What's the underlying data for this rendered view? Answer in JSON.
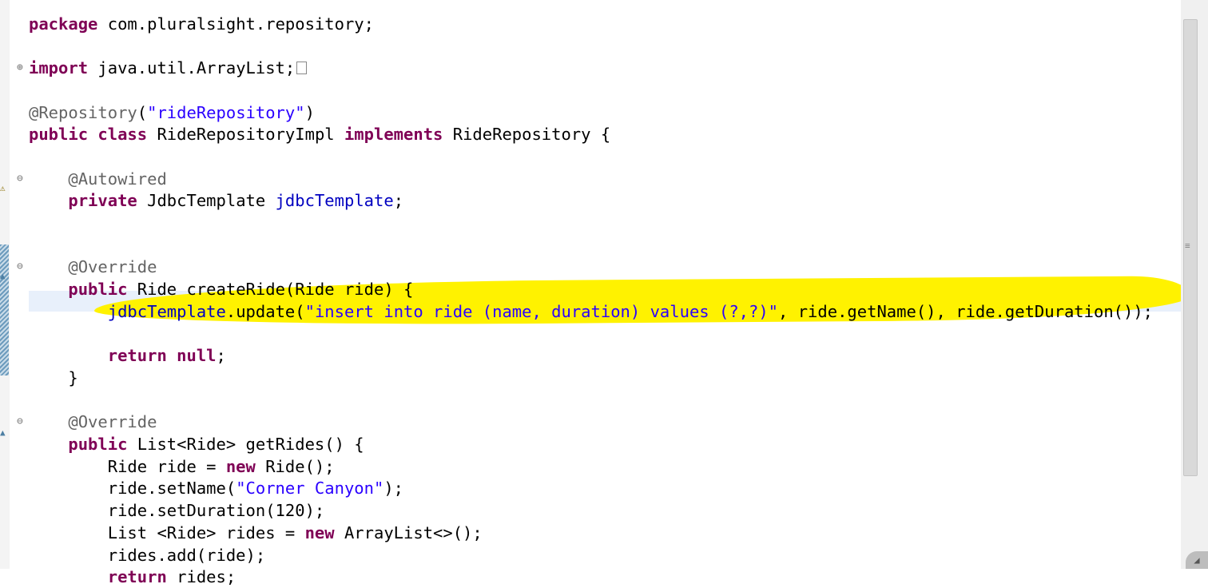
{
  "editor": {
    "language": "java",
    "lines": [
      {
        "row": 1,
        "tokens": [
          {
            "t": "package",
            "c": "kw"
          },
          {
            "t": " com.pluralsight.repository;"
          }
        ]
      },
      {
        "row": 3,
        "tokens": [
          {
            "t": "import",
            "c": "kw"
          },
          {
            "t": " java.util.ArrayList;"
          }
        ],
        "folded": true
      },
      {
        "row": 5,
        "tokens": [
          {
            "t": "@Repository",
            "c": "ann"
          },
          {
            "t": "("
          },
          {
            "t": "\"rideRepository\"",
            "c": "str"
          },
          {
            "t": ")"
          }
        ]
      },
      {
        "row": 6,
        "tokens": [
          {
            "t": "public",
            "c": "kw"
          },
          {
            "t": " "
          },
          {
            "t": "class",
            "c": "kw"
          },
          {
            "t": " RideRepositoryImpl "
          },
          {
            "t": "implements",
            "c": "kw"
          },
          {
            "t": " RideRepository {"
          }
        ]
      },
      {
        "row": 8,
        "tokens": [
          {
            "t": "    "
          },
          {
            "t": "@Autowired",
            "c": "ann"
          }
        ]
      },
      {
        "row": 9,
        "tokens": [
          {
            "t": "    "
          },
          {
            "t": "private",
            "c": "kw"
          },
          {
            "t": " JdbcTemplate "
          },
          {
            "t": "jdbcTemplate",
            "c": "field"
          },
          {
            "t": ";"
          }
        ]
      },
      {
        "row": 12,
        "tokens": [
          {
            "t": "    "
          },
          {
            "t": "@Override",
            "c": "ann"
          }
        ]
      },
      {
        "row": 13,
        "tokens": [
          {
            "t": "    "
          },
          {
            "t": "public",
            "c": "kw"
          },
          {
            "t": " Ride createRide(Ride ride) {"
          }
        ]
      },
      {
        "row": 14,
        "tokens": [
          {
            "t": "        "
          },
          {
            "t": "jdbcTemplate",
            "c": "field"
          },
          {
            "t": ".update("
          },
          {
            "t": "\"insert into ride (name, duration) values (?,?)\"",
            "c": "str"
          },
          {
            "t": ", ride.getName(), ride.getDuration());"
          }
        ],
        "current": true
      },
      {
        "row": 16,
        "tokens": [
          {
            "t": "        "
          },
          {
            "t": "return",
            "c": "kw"
          },
          {
            "t": " "
          },
          {
            "t": "null",
            "c": "kw"
          },
          {
            "t": ";"
          }
        ]
      },
      {
        "row": 17,
        "tokens": [
          {
            "t": "    }"
          }
        ]
      },
      {
        "row": 19,
        "tokens": [
          {
            "t": "    "
          },
          {
            "t": "@Override",
            "c": "ann"
          }
        ]
      },
      {
        "row": 20,
        "tokens": [
          {
            "t": "    "
          },
          {
            "t": "public",
            "c": "kw"
          },
          {
            "t": " List<Ride> getRides() {"
          }
        ]
      },
      {
        "row": 21,
        "tokens": [
          {
            "t": "        Ride ride = "
          },
          {
            "t": "new",
            "c": "kw"
          },
          {
            "t": " Ride();"
          }
        ]
      },
      {
        "row": 22,
        "tokens": [
          {
            "t": "        ride.setName("
          },
          {
            "t": "\"Corner Canyon\"",
            "c": "str"
          },
          {
            "t": ");"
          }
        ]
      },
      {
        "row": 23,
        "tokens": [
          {
            "t": "        ride.setDuration(120);"
          }
        ]
      },
      {
        "row": 24,
        "tokens": [
          {
            "t": "        List <Ride> rides = "
          },
          {
            "t": "new",
            "c": "kw"
          },
          {
            "t": " ArrayList<>();"
          }
        ]
      },
      {
        "row": 25,
        "tokens": [
          {
            "t": "        rides.add(ride);"
          }
        ]
      },
      {
        "row": 26,
        "tokens": [
          {
            "t": "        "
          },
          {
            "t": "return",
            "c": "kw"
          },
          {
            "t": " rides;"
          }
        ]
      }
    ],
    "gutter_markers": [
      {
        "row": 3,
        "icon": "expand-fold-icon",
        "glyph": "⊕"
      },
      {
        "row": 8,
        "icon": "collapse-fold-icon",
        "glyph": "⊖"
      },
      {
        "row": 12,
        "icon": "collapse-fold-icon",
        "glyph": "⊖"
      },
      {
        "row": 19,
        "icon": "collapse-fold-icon",
        "glyph": "⊖"
      }
    ],
    "highlight_color": "#fff200",
    "colors": {
      "keyword": "#7f0055",
      "string": "#2a00ff",
      "field": "#0000c0",
      "annotation": "#646464"
    }
  }
}
